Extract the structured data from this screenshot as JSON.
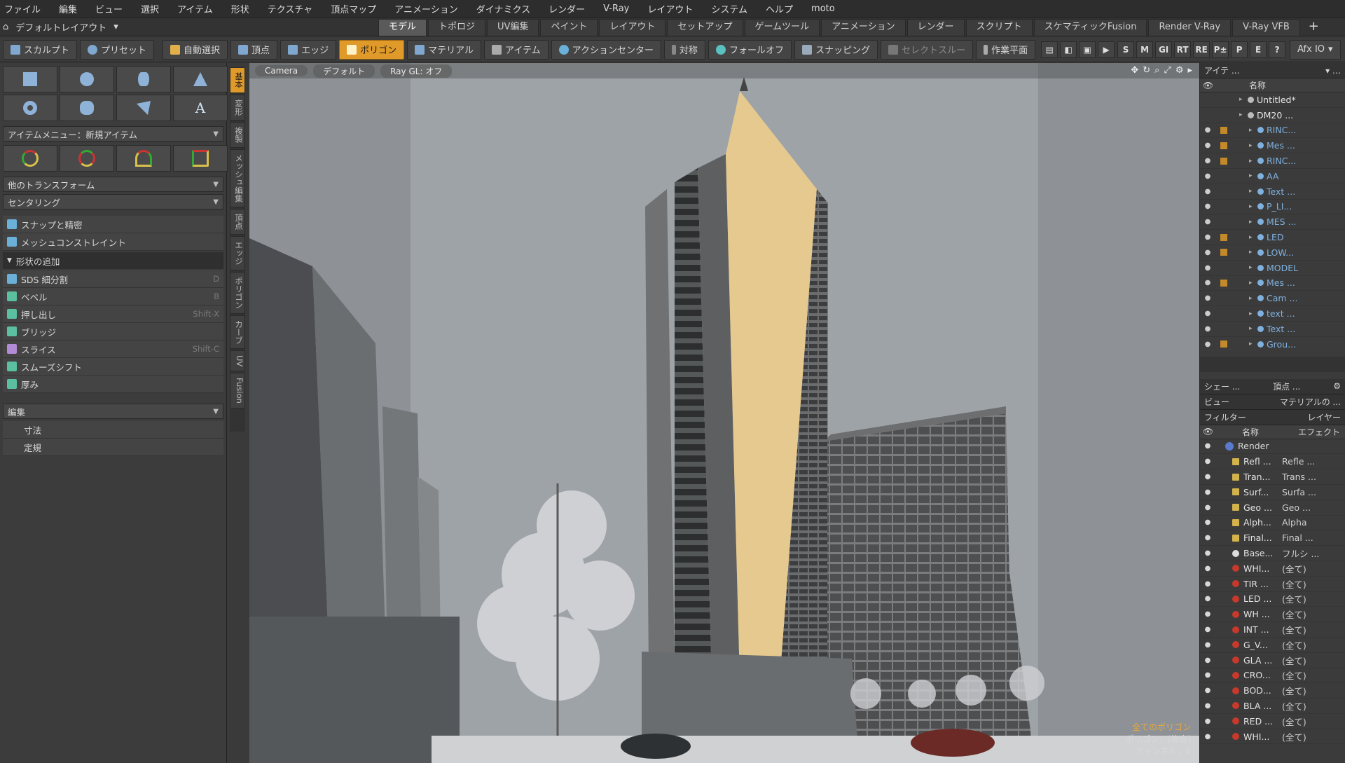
{
  "menu": [
    "ファイル",
    "編集",
    "ビュー",
    "選択",
    "アイテム",
    "形状",
    "テクスチャ",
    "頂点マップ",
    "アニメーション",
    "ダイナミクス",
    "レンダー",
    "V-Ray",
    "レイアウト",
    "システム",
    "ヘルプ",
    "moto"
  ],
  "layout": {
    "label": "デフォルトレイアウト"
  },
  "tabs": [
    "モデル",
    "トポロジ",
    "UV編集",
    "ペイント",
    "レイアウト",
    "セットアップ",
    "ゲームツール",
    "アニメーション",
    "レンダー",
    "スクリプト",
    "スケマティックFusion",
    "Render V-Ray",
    "V-Ray VFB"
  ],
  "toolbar": {
    "sculpt": "スカルプト",
    "preset": "プリセット",
    "auto_select": "自動選択",
    "vertex": "頂点",
    "edge": "エッジ",
    "polygon": "ポリゴン",
    "material": "マテリアル",
    "item": "アイテム",
    "action_center": "アクションセンター",
    "symmetry": "対称",
    "falloff": "フォールオフ",
    "snapping": "スナッピング",
    "select_through": "セレクトスルー",
    "work_plane": "作業平面",
    "afx": "Afx IO",
    "right_icons": [
      "S",
      "M",
      "GI",
      "RT",
      "RE",
      "P±",
      "P",
      "E",
      "?"
    ]
  },
  "left": {
    "item_menu": "アイテムメニュー：新規アイテム",
    "other_transform": "他のトランスフォーム",
    "centering": "センタリング",
    "snap": "スナップと精密",
    "mesh_constraint": "メッシュコンストレイント",
    "add_shape": "形状の追加",
    "tools": [
      {
        "label": "SDS 細分割",
        "shortcut": "D"
      },
      {
        "label": "ベベル",
        "shortcut": "B"
      },
      {
        "label": "押し出し",
        "shortcut": "Shift-X"
      },
      {
        "label": "ブリッジ",
        "shortcut": ""
      },
      {
        "label": "スライス",
        "shortcut": "Shift-C"
      },
      {
        "label": "スムーズシフト",
        "shortcut": ""
      },
      {
        "label": "厚み",
        "shortcut": ""
      }
    ],
    "edit": "編集",
    "dimension": "寸法",
    "ruler": "定規",
    "vtabs": [
      "基本",
      "変形",
      "複製",
      "メッシュ編集",
      "頂点",
      "エッジ",
      "ポリゴン",
      "カーブ",
      "UV",
      "Fusion"
    ]
  },
  "viewport": {
    "camera": "Camera",
    "default": "デフォルト",
    "raygl": "Ray GL: オフ",
    "info_line1": "全てのポリゴン",
    "info_line2": "ポリゴン：(複合)",
    "info_line3": "チャンネル：0"
  },
  "items_panel": {
    "title": "アイテ ...",
    "col_name": "名称",
    "rows": [
      {
        "name": "Untitled*",
        "lock": false,
        "white": true
      },
      {
        "name": "DM20 ...",
        "lock": false,
        "white": true
      },
      {
        "name": "RINC...",
        "lock": true,
        "white": false
      },
      {
        "name": "Mes ...",
        "lock": true,
        "white": false
      },
      {
        "name": "RINC...",
        "lock": true,
        "white": false
      },
      {
        "name": "AA",
        "lock": false,
        "white": false
      },
      {
        "name": "Text ...",
        "lock": false,
        "white": false
      },
      {
        "name": "P_LI...",
        "lock": false,
        "white": false
      },
      {
        "name": "MES ...",
        "lock": false,
        "white": false
      },
      {
        "name": "LED",
        "lock": true,
        "white": false
      },
      {
        "name": "LOW...",
        "lock": true,
        "white": false
      },
      {
        "name": "MODEL",
        "lock": false,
        "white": false
      },
      {
        "name": "Mes ...",
        "lock": true,
        "white": false
      },
      {
        "name": "Cam ...",
        "lock": false,
        "white": false
      },
      {
        "name": "text ...",
        "lock": false,
        "white": false
      },
      {
        "name": "Text ...",
        "lock": false,
        "white": false
      },
      {
        "name": "Grou...",
        "lock": true,
        "white": false
      }
    ]
  },
  "shader_panel": {
    "tab1": "シェー ...",
    "tab2": "頂点 ...",
    "view": "ビュー",
    "material": "マテリアルの ...",
    "filter": "フィルター",
    "layer": "レイヤー",
    "col_name": "名称",
    "col_effect": "エフェクト",
    "render": "Render",
    "rows": [
      {
        "n": "Refl ...",
        "e": "Refle ...",
        "t": "tx"
      },
      {
        "n": "Tran...",
        "e": "Trans ...",
        "t": "tx"
      },
      {
        "n": "Surf...",
        "e": "Surfa ...",
        "t": "tx"
      },
      {
        "n": "Geo ...",
        "e": "Geo ...",
        "t": "tx"
      },
      {
        "n": "Alph...",
        "e": "Alpha",
        "t": "tx"
      },
      {
        "n": "Final...",
        "e": "Final ...",
        "t": "tx"
      },
      {
        "n": "Base...",
        "e": "フルシ ...",
        "t": "wh"
      },
      {
        "n": "WHI...",
        "e": "(全て)",
        "t": "m"
      },
      {
        "n": "TIR ...",
        "e": "(全て)",
        "t": "m"
      },
      {
        "n": "LED ...",
        "e": "(全て)",
        "t": "m"
      },
      {
        "n": "WH ...",
        "e": "(全て)",
        "t": "m"
      },
      {
        "n": "INT ...",
        "e": "(全て)",
        "t": "m"
      },
      {
        "n": "G_V...",
        "e": "(全て)",
        "t": "m"
      },
      {
        "n": "GLA ...",
        "e": "(全て)",
        "t": "m"
      },
      {
        "n": "CRO...",
        "e": "(全て)",
        "t": "m"
      },
      {
        "n": "BOD...",
        "e": "(全て)",
        "t": "m"
      },
      {
        "n": "BLA ...",
        "e": "(全て)",
        "t": "m"
      },
      {
        "n": "RED ...",
        "e": "(全て)",
        "t": "m"
      },
      {
        "n": "WHI...",
        "e": "(全て)",
        "t": "m"
      }
    ]
  }
}
